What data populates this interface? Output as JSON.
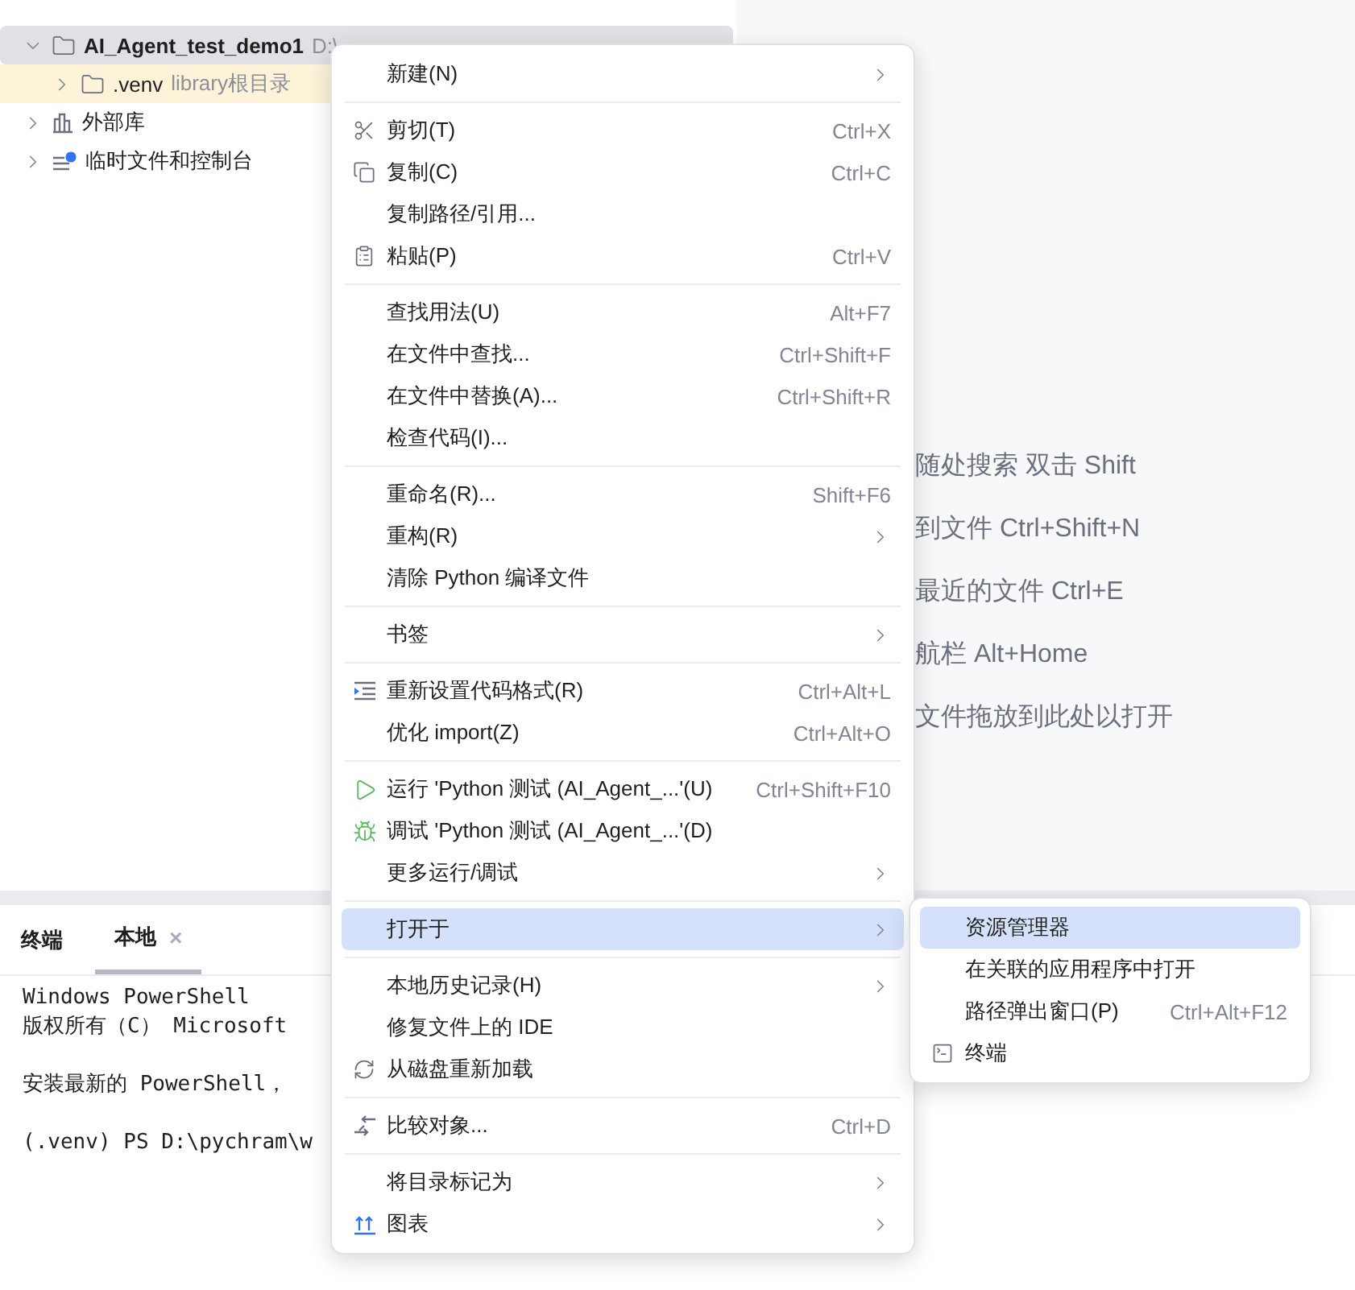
{
  "project_tree": {
    "items": [
      {
        "kind": "folder",
        "name": "AI_Agent_test_demo1",
        "hint": "D:\\",
        "selected": true,
        "expanded": true,
        "children": [
          {
            "kind": "library",
            "name": ".venv",
            "hint": "library根目录",
            "selected": false,
            "expanded": false
          }
        ]
      },
      {
        "kind": "libraries",
        "name": "外部库",
        "selected": false,
        "expanded": false
      },
      {
        "kind": "scratches",
        "name": "临时文件和控制台",
        "selected": false,
        "expanded": false
      }
    ]
  },
  "editor_hints": [
    "随处搜索 双击 Shift",
    "到文件 Ctrl+Shift+N",
    "最近的文件 Ctrl+E",
    "航栏 Alt+Home",
    "文件拖放到此处以打开"
  ],
  "terminal": {
    "title": "终端",
    "tabs": [
      {
        "label": "本地",
        "selected": true,
        "close": "×"
      }
    ],
    "paragraphs": [
      [
        "Windows PowerShell",
        "版权所有（C） Microsoft"
      ],
      [
        "安装最新的 PowerShell，"
      ],
      [
        "(.venv) PS D:\\pychram\\w"
      ]
    ]
  },
  "context_menu": {
    "items": [
      {
        "kind": "item",
        "label": "新建(N)",
        "submenu": true,
        "selected": false
      },
      {
        "kind": "separator"
      },
      {
        "kind": "item",
        "label": "剪切(T)",
        "shortcut": "Ctrl+X",
        "selected": false
      },
      {
        "kind": "item",
        "label": "复制(C)",
        "shortcut": "Ctrl+C",
        "selected": false
      },
      {
        "kind": "item",
        "label": "复制路径/引用...",
        "selected": false
      },
      {
        "kind": "item",
        "label": "粘贴(P)",
        "shortcut": "Ctrl+V",
        "selected": false
      },
      {
        "kind": "separator"
      },
      {
        "kind": "item",
        "label": "查找用法(U)",
        "shortcut": "Alt+F7",
        "selected": false
      },
      {
        "kind": "item",
        "label": "在文件中查找...",
        "shortcut": "Ctrl+Shift+F",
        "selected": false
      },
      {
        "kind": "item",
        "label": "在文件中替换(A)...",
        "shortcut": "Ctrl+Shift+R",
        "selected": false
      },
      {
        "kind": "item",
        "label": "检查代码(I)...",
        "selected": false
      },
      {
        "kind": "separator"
      },
      {
        "kind": "item",
        "label": "重命名(R)...",
        "shortcut": "Shift+F6",
        "selected": false
      },
      {
        "kind": "item",
        "label": "重构(R)",
        "submenu": true,
        "selected": false
      },
      {
        "kind": "item",
        "label": "清除 Python 编译文件",
        "selected": false
      },
      {
        "kind": "separator"
      },
      {
        "kind": "item",
        "label": "书签",
        "submenu": true,
        "selected": false
      },
      {
        "kind": "separator"
      },
      {
        "kind": "item",
        "label": "重新设置代码格式(R)",
        "shortcut": "Ctrl+Alt+L",
        "selected": false
      },
      {
        "kind": "item",
        "label": "优化 import(Z)",
        "shortcut": "Ctrl+Alt+O",
        "selected": false
      },
      {
        "kind": "separator"
      },
      {
        "kind": "item",
        "label": "运行 'Python 测试 (AI_Agent_...'(U)",
        "shortcut": "Ctrl+Shift+F10",
        "selected": false
      },
      {
        "kind": "item",
        "label": "调试 'Python 测试 (AI_Agent_...'(D)",
        "selected": false
      },
      {
        "kind": "item",
        "label": "更多运行/调试",
        "submenu": true,
        "selected": false
      },
      {
        "kind": "separator"
      },
      {
        "kind": "item",
        "label": "打开于",
        "submenu": true,
        "selected": true
      },
      {
        "kind": "separator"
      },
      {
        "kind": "item",
        "label": "本地历史记录(H)",
        "submenu": true,
        "selected": false
      },
      {
        "kind": "item",
        "label": "修复文件上的 IDE",
        "selected": false
      },
      {
        "kind": "item",
        "label": "从磁盘重新加载",
        "selected": false
      },
      {
        "kind": "separator"
      },
      {
        "kind": "item",
        "label": "比较对象...",
        "shortcut": "Ctrl+D",
        "selected": false
      },
      {
        "kind": "separator"
      },
      {
        "kind": "item",
        "label": "将目录标记为",
        "submenu": true,
        "selected": false
      },
      {
        "kind": "item",
        "label": "图表",
        "submenu": true,
        "selected": false
      }
    ]
  },
  "open_in_submenu": {
    "items": [
      {
        "kind": "item",
        "label": "资源管理器",
        "selected": true
      },
      {
        "kind": "item",
        "label": "在关联的应用程序中打开",
        "selected": false
      },
      {
        "kind": "item",
        "label": "路径弹出窗口(P)",
        "shortcut": "Ctrl+Alt+F12",
        "selected": false
      },
      {
        "kind": "item",
        "label": "终端",
        "selected": false
      }
    ]
  }
}
